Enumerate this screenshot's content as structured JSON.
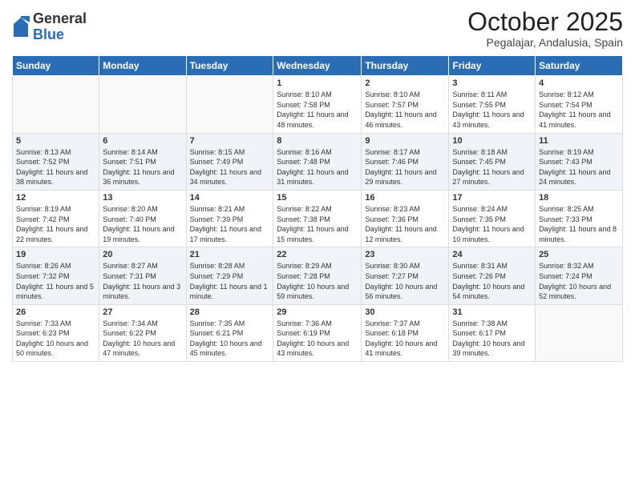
{
  "header": {
    "logo_general": "General",
    "logo_blue": "Blue",
    "month_title": "October 2025",
    "location": "Pegalajar, Andalusia, Spain"
  },
  "days_of_week": [
    "Sunday",
    "Monday",
    "Tuesday",
    "Wednesday",
    "Thursday",
    "Friday",
    "Saturday"
  ],
  "weeks": [
    [
      {
        "day": "",
        "info": ""
      },
      {
        "day": "",
        "info": ""
      },
      {
        "day": "",
        "info": ""
      },
      {
        "day": "1",
        "info": "Sunrise: 8:10 AM\nSunset: 7:58 PM\nDaylight: 11 hours and 48 minutes."
      },
      {
        "day": "2",
        "info": "Sunrise: 8:10 AM\nSunset: 7:57 PM\nDaylight: 11 hours and 46 minutes."
      },
      {
        "day": "3",
        "info": "Sunrise: 8:11 AM\nSunset: 7:55 PM\nDaylight: 11 hours and 43 minutes."
      },
      {
        "day": "4",
        "info": "Sunrise: 8:12 AM\nSunset: 7:54 PM\nDaylight: 11 hours and 41 minutes."
      }
    ],
    [
      {
        "day": "5",
        "info": "Sunrise: 8:13 AM\nSunset: 7:52 PM\nDaylight: 11 hours and 38 minutes."
      },
      {
        "day": "6",
        "info": "Sunrise: 8:14 AM\nSunset: 7:51 PM\nDaylight: 11 hours and 36 minutes."
      },
      {
        "day": "7",
        "info": "Sunrise: 8:15 AM\nSunset: 7:49 PM\nDaylight: 11 hours and 34 minutes."
      },
      {
        "day": "8",
        "info": "Sunrise: 8:16 AM\nSunset: 7:48 PM\nDaylight: 11 hours and 31 minutes."
      },
      {
        "day": "9",
        "info": "Sunrise: 8:17 AM\nSunset: 7:46 PM\nDaylight: 11 hours and 29 minutes."
      },
      {
        "day": "10",
        "info": "Sunrise: 8:18 AM\nSunset: 7:45 PM\nDaylight: 11 hours and 27 minutes."
      },
      {
        "day": "11",
        "info": "Sunrise: 8:19 AM\nSunset: 7:43 PM\nDaylight: 11 hours and 24 minutes."
      }
    ],
    [
      {
        "day": "12",
        "info": "Sunrise: 8:19 AM\nSunset: 7:42 PM\nDaylight: 11 hours and 22 minutes."
      },
      {
        "day": "13",
        "info": "Sunrise: 8:20 AM\nSunset: 7:40 PM\nDaylight: 11 hours and 19 minutes."
      },
      {
        "day": "14",
        "info": "Sunrise: 8:21 AM\nSunset: 7:39 PM\nDaylight: 11 hours and 17 minutes."
      },
      {
        "day": "15",
        "info": "Sunrise: 8:22 AM\nSunset: 7:38 PM\nDaylight: 11 hours and 15 minutes."
      },
      {
        "day": "16",
        "info": "Sunrise: 8:23 AM\nSunset: 7:36 PM\nDaylight: 11 hours and 12 minutes."
      },
      {
        "day": "17",
        "info": "Sunrise: 8:24 AM\nSunset: 7:35 PM\nDaylight: 11 hours and 10 minutes."
      },
      {
        "day": "18",
        "info": "Sunrise: 8:25 AM\nSunset: 7:33 PM\nDaylight: 11 hours and 8 minutes."
      }
    ],
    [
      {
        "day": "19",
        "info": "Sunrise: 8:26 AM\nSunset: 7:32 PM\nDaylight: 11 hours and 5 minutes."
      },
      {
        "day": "20",
        "info": "Sunrise: 8:27 AM\nSunset: 7:31 PM\nDaylight: 11 hours and 3 minutes."
      },
      {
        "day": "21",
        "info": "Sunrise: 8:28 AM\nSunset: 7:29 PM\nDaylight: 11 hours and 1 minute."
      },
      {
        "day": "22",
        "info": "Sunrise: 8:29 AM\nSunset: 7:28 PM\nDaylight: 10 hours and 59 minutes."
      },
      {
        "day": "23",
        "info": "Sunrise: 8:30 AM\nSunset: 7:27 PM\nDaylight: 10 hours and 56 minutes."
      },
      {
        "day": "24",
        "info": "Sunrise: 8:31 AM\nSunset: 7:26 PM\nDaylight: 10 hours and 54 minutes."
      },
      {
        "day": "25",
        "info": "Sunrise: 8:32 AM\nSunset: 7:24 PM\nDaylight: 10 hours and 52 minutes."
      }
    ],
    [
      {
        "day": "26",
        "info": "Sunrise: 7:33 AM\nSunset: 6:23 PM\nDaylight: 10 hours and 50 minutes."
      },
      {
        "day": "27",
        "info": "Sunrise: 7:34 AM\nSunset: 6:22 PM\nDaylight: 10 hours and 47 minutes."
      },
      {
        "day": "28",
        "info": "Sunrise: 7:35 AM\nSunset: 6:21 PM\nDaylight: 10 hours and 45 minutes."
      },
      {
        "day": "29",
        "info": "Sunrise: 7:36 AM\nSunset: 6:19 PM\nDaylight: 10 hours and 43 minutes."
      },
      {
        "day": "30",
        "info": "Sunrise: 7:37 AM\nSunset: 6:18 PM\nDaylight: 10 hours and 41 minutes."
      },
      {
        "day": "31",
        "info": "Sunrise: 7:38 AM\nSunset: 6:17 PM\nDaylight: 10 hours and 39 minutes."
      },
      {
        "day": "",
        "info": ""
      }
    ]
  ]
}
